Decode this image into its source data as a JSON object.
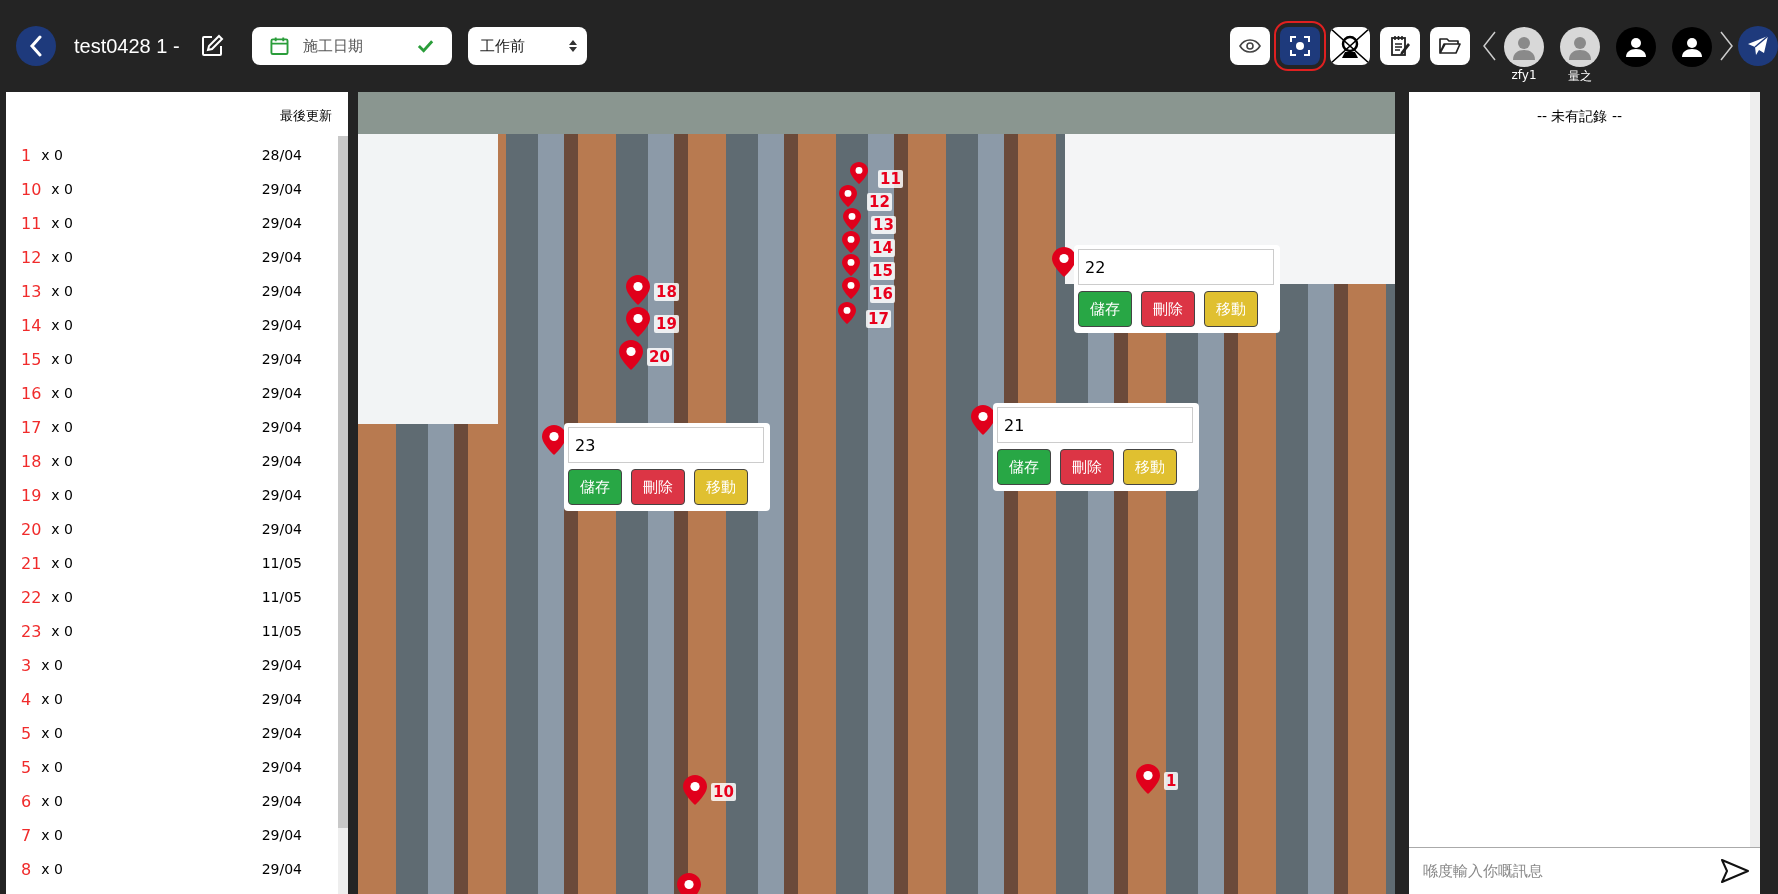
{
  "header": {
    "title": "test0428 1 -",
    "date_field": {
      "placeholder": "施工日期",
      "confirmed": true
    },
    "stage_select": {
      "value": "工作前"
    },
    "tools": [
      {
        "kind": "view",
        "selected": false
      },
      {
        "kind": "capture",
        "selected": true
      },
      {
        "kind": "camera-off",
        "selected": false
      },
      {
        "kind": "notes",
        "selected": false
      },
      {
        "kind": "folder",
        "selected": false
      }
    ],
    "users": [
      {
        "name": "zfy1",
        "kind": "photo"
      },
      {
        "name": "量之",
        "kind": "photo"
      },
      {
        "kind": "generic"
      },
      {
        "kind": "generic"
      }
    ]
  },
  "markers_list": {
    "column_header": "最後更新",
    "rows": [
      {
        "label": "1",
        "count": "x 0",
        "updated": "28/04"
      },
      {
        "label": "10",
        "count": "x 0",
        "updated": "29/04"
      },
      {
        "label": "11",
        "count": "x 0",
        "updated": "29/04"
      },
      {
        "label": "12",
        "count": "x 0",
        "updated": "29/04"
      },
      {
        "label": "13",
        "count": "x 0",
        "updated": "29/04"
      },
      {
        "label": "14",
        "count": "x 0",
        "updated": "29/04"
      },
      {
        "label": "15",
        "count": "x 0",
        "updated": "29/04"
      },
      {
        "label": "16",
        "count": "x 0",
        "updated": "29/04"
      },
      {
        "label": "17",
        "count": "x 0",
        "updated": "29/04"
      },
      {
        "label": "18",
        "count": "x 0",
        "updated": "29/04"
      },
      {
        "label": "19",
        "count": "x 0",
        "updated": "29/04"
      },
      {
        "label": "20",
        "count": "x 0",
        "updated": "29/04"
      },
      {
        "label": "21",
        "count": "x 0",
        "updated": "11/05"
      },
      {
        "label": "22",
        "count": "x 0",
        "updated": "11/05"
      },
      {
        "label": "23",
        "count": "x 0",
        "updated": "11/05"
      },
      {
        "label": "3",
        "count": "x 0",
        "updated": "29/04"
      },
      {
        "label": "4",
        "count": "x 0",
        "updated": "29/04"
      },
      {
        "label": "5",
        "count": "x 0",
        "updated": "29/04"
      },
      {
        "label": "5",
        "count": "x 0",
        "updated": "29/04"
      },
      {
        "label": "6",
        "count": "x 0",
        "updated": "29/04"
      },
      {
        "label": "7",
        "count": "x 0",
        "updated": "29/04"
      },
      {
        "label": "8",
        "count": "x 0",
        "updated": "29/04"
      }
    ]
  },
  "photo": {
    "pins": [
      {
        "kind": "labeled",
        "label": "11"
      },
      {
        "kind": "labeled",
        "label": "12"
      },
      {
        "kind": "labeled",
        "label": "13"
      },
      {
        "kind": "labeled",
        "label": "14"
      },
      {
        "kind": "labeled",
        "label": "15"
      },
      {
        "kind": "labeled",
        "label": "16"
      },
      {
        "kind": "labeled",
        "label": "17"
      },
      {
        "kind": "labeled",
        "label": "18"
      },
      {
        "kind": "labeled",
        "label": "19"
      },
      {
        "kind": "labeled",
        "label": "20"
      },
      {
        "kind": "editing",
        "editor": {
          "value": "22",
          "actions": [
            {
              "label": "儲存",
              "kind": "save"
            },
            {
              "label": "刪除",
              "kind": "delete"
            },
            {
              "label": "移動",
              "kind": "move"
            }
          ]
        }
      },
      {
        "kind": "editing",
        "editor": {
          "value": "21",
          "actions": [
            {
              "label": "儲存",
              "kind": "save"
            },
            {
              "label": "刪除",
              "kind": "delete"
            },
            {
              "label": "移動",
              "kind": "move"
            }
          ]
        }
      },
      {
        "kind": "editing",
        "editor": {
          "value": "23",
          "actions": [
            {
              "label": "儲存",
              "kind": "save"
            },
            {
              "label": "刪除",
              "kind": "delete"
            },
            {
              "label": "移動",
              "kind": "move"
            }
          ]
        }
      },
      {
        "kind": "labeled",
        "label": "10"
      },
      {
        "kind": "labeled",
        "label": "1"
      },
      {
        "kind": "plain"
      }
    ]
  },
  "chat": {
    "empty_text": "-- 未有記錄 --",
    "input": {
      "placeholder": "喺度輸入你嘅訊息"
    }
  }
}
